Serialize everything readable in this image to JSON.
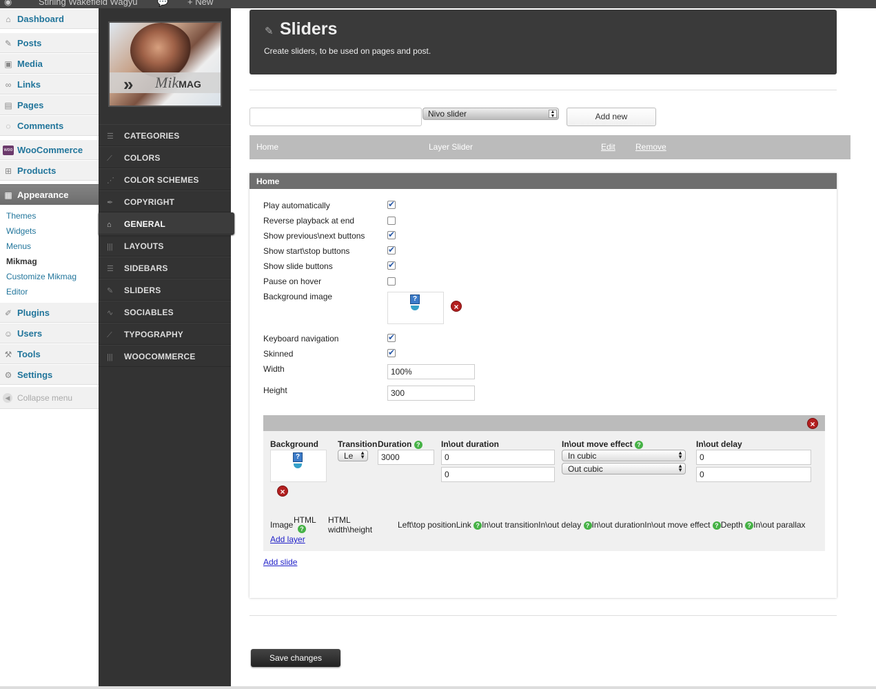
{
  "admin_bar": {
    "site_name": "Stirling Wakefield Wagyu",
    "new_label": "New"
  },
  "wp_menu": {
    "items": [
      {
        "label": "Dashboard",
        "icon": "dashboard-icon"
      },
      {
        "label": "Posts",
        "icon": "pin-icon"
      },
      {
        "label": "Media",
        "icon": "media-icon"
      },
      {
        "label": "Links",
        "icon": "link-icon"
      },
      {
        "label": "Pages",
        "icon": "pages-icon"
      },
      {
        "label": "Comments",
        "icon": "comment-icon"
      },
      {
        "label": "WooCommerce",
        "icon": "woo-icon"
      },
      {
        "label": "Products",
        "icon": "cart-icon"
      },
      {
        "label": "Appearance",
        "icon": "appearance-icon"
      },
      {
        "label": "Plugins",
        "icon": "plug-icon"
      },
      {
        "label": "Users",
        "icon": "users-icon"
      },
      {
        "label": "Tools",
        "icon": "tools-icon"
      },
      {
        "label": "Settings",
        "icon": "settings-icon"
      }
    ],
    "appearance_sub": [
      "Themes",
      "Widgets",
      "Menus",
      "Mikmag",
      "Customize Mikmag",
      "Editor"
    ],
    "collapse_label": "Collapse menu"
  },
  "theme_nav": {
    "logo_text": "Mik",
    "logo_text_bold": "MAG",
    "items": [
      "CATEGORIES",
      "COLORS",
      "COLOR SCHEMES",
      "COPYRIGHT",
      "GENERAL",
      "LAYOUTS",
      "SIDEBARS",
      "SLIDERS",
      "SOCIABLES",
      "TYPOGRAPHY",
      "WOOCOMMERCE"
    ],
    "active": "GENERAL"
  },
  "header": {
    "title": "Sliders",
    "subtitle": "Create sliders, to be used on pages and post."
  },
  "new_slider": {
    "name_value": "",
    "type_value": "Nivo slider",
    "add_label": "Add new"
  },
  "slider_list": [
    {
      "name": "Home",
      "type": "Layer Slider",
      "edit": "Edit",
      "remove": "Remove"
    }
  ],
  "panel": {
    "title": "Home",
    "options": [
      {
        "label": "Play automatically",
        "checked": true
      },
      {
        "label": "Reverse playback at end",
        "checked": false
      },
      {
        "label": "Show previous\\next buttons",
        "checked": true
      },
      {
        "label": "Show start\\stop buttons",
        "checked": true
      },
      {
        "label": "Show slide buttons",
        "checked": true
      },
      {
        "label": "Pause on hover",
        "checked": false
      }
    ],
    "background_image_label": "Background image",
    "options2": [
      {
        "label": "Keyboard navigation",
        "checked": true
      },
      {
        "label": "Skinned",
        "checked": true
      }
    ],
    "width_label": "Width",
    "width_value": "100%",
    "height_label": "Height",
    "height_value": "300",
    "slide": {
      "background_label": "Background",
      "transition_label": "Transition",
      "transition_value": "Le",
      "duration_label": "Duration",
      "duration_value": "3000",
      "inout_duration_label": "In\\out duration",
      "inout_duration_values": [
        "0",
        "0"
      ],
      "inout_move_label": "In\\out move effect",
      "inout_move_values": [
        "In cubic",
        "Out cubic"
      ],
      "inout_delay_label": "In\\out delay",
      "inout_delay_values": [
        "0",
        "0"
      ],
      "layer_cols": {
        "image": "Image",
        "html": "HTML",
        "html_wh": "HTML width\\height",
        "lefttop": "Left\\top position",
        "link": "Link",
        "inout_transition": "In\\out transition",
        "inout_delay": "In\\out delay",
        "inout_duration": "In\\out duration",
        "inout_move": "In\\out move effect",
        "depth": "Depth",
        "parallax": "In\\out parallax"
      },
      "add_layer": "Add layer"
    },
    "add_slide": "Add slide"
  },
  "save_label": "Save changes",
  "colors": {
    "wp_link": "#21759b",
    "dark_nav": "#333333",
    "panel_header": "#6e6e6e",
    "remove_red": "#b32020",
    "help_green": "#46b246"
  }
}
